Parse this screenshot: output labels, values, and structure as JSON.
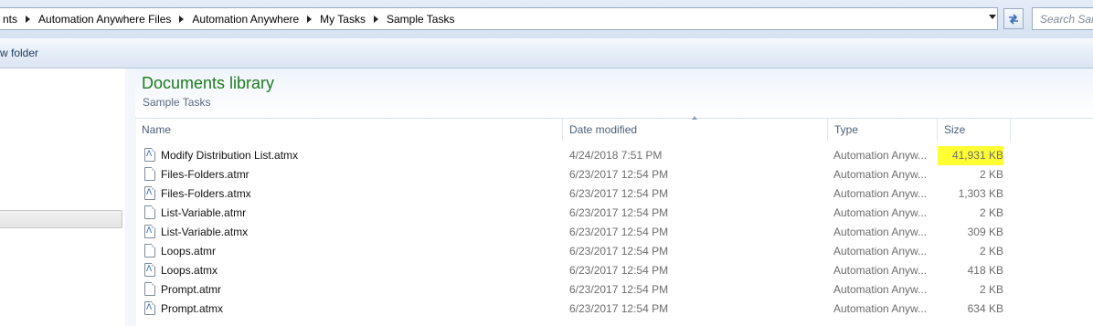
{
  "address_bar": {
    "crumbs": [
      "nts",
      "Automation Anywhere Files",
      "Automation Anywhere",
      "My Tasks",
      "Sample Tasks"
    ]
  },
  "search": {
    "placeholder": "Search Sam"
  },
  "toolbar": {
    "new_folder_label": "w folder"
  },
  "library": {
    "title": "Documents library",
    "subtitle": "Sample Tasks"
  },
  "columns": {
    "name": "Name",
    "date": "Date modified",
    "type": "Type",
    "size": "Size"
  },
  "files": [
    {
      "name": "Modify Distribution List.atmx",
      "date": "4/24/2018 7:51 PM",
      "type": "Automation Anyw...",
      "size": "41,931 KB",
      "kind": "atmx",
      "highlighted": true
    },
    {
      "name": "Files-Folders.atmr",
      "date": "6/23/2017 12:54 PM",
      "type": "Automation Anyw...",
      "size": "2 KB",
      "kind": "atmr"
    },
    {
      "name": "Files-Folders.atmx",
      "date": "6/23/2017 12:54 PM",
      "type": "Automation Anyw...",
      "size": "1,303 KB",
      "kind": "atmx"
    },
    {
      "name": "List-Variable.atmr",
      "date": "6/23/2017 12:54 PM",
      "type": "Automation Anyw...",
      "size": "2 KB",
      "kind": "atmr"
    },
    {
      "name": "List-Variable.atmx",
      "date": "6/23/2017 12:54 PM",
      "type": "Automation Anyw...",
      "size": "309 KB",
      "kind": "atmx"
    },
    {
      "name": "Loops.atmr",
      "date": "6/23/2017 12:54 PM",
      "type": "Automation Anyw...",
      "size": "2 KB",
      "kind": "atmr"
    },
    {
      "name": "Loops.atmx",
      "date": "6/23/2017 12:54 PM",
      "type": "Automation Anyw...",
      "size": "418 KB",
      "kind": "atmx"
    },
    {
      "name": "Prompt.atmr",
      "date": "6/23/2017 12:54 PM",
      "type": "Automation Anyw...",
      "size": "2 KB",
      "kind": "atmr"
    },
    {
      "name": "Prompt.atmx",
      "date": "6/23/2017 12:54 PM",
      "type": "Automation Anyw...",
      "size": "634 KB",
      "kind": "atmx"
    }
  ],
  "colors": {
    "library_title": "#1e7b1e",
    "highlight": "#ffff33"
  },
  "icons": {
    "atmx": "automation-file-icon",
    "atmr": "document-icon"
  }
}
